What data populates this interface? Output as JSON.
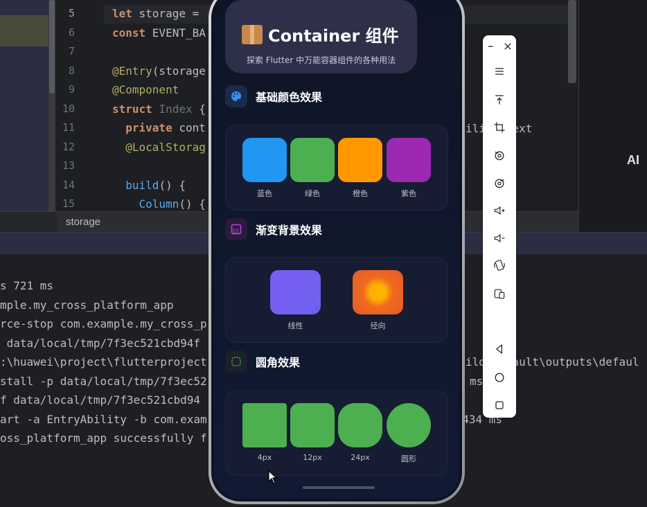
{
  "ide": {
    "line_numbers": [
      "5",
      "6",
      "7",
      "8",
      "9",
      "10",
      "11",
      "12",
      "13",
      "14",
      "15"
    ],
    "code_lines": [
      {
        "n": "5",
        "parts": [
          [
            "kw",
            "let "
          ],
          [
            "",
            "storage = "
          ]
        ]
      },
      {
        "n": "6",
        "parts": [
          [
            "kw",
            "const "
          ],
          [
            "",
            "EVENT_BA"
          ]
        ]
      },
      {
        "n": "7",
        "parts": []
      },
      {
        "n": "8",
        "parts": [
          [
            "ann",
            "@Entry"
          ],
          [
            "",
            "(storage"
          ]
        ]
      },
      {
        "n": "9",
        "parts": [
          [
            "ann",
            "@Component"
          ]
        ]
      },
      {
        "n": "10",
        "parts": [
          [
            "kw",
            "struct "
          ],
          [
            "typ",
            "Index "
          ],
          [
            "",
            "{"
          ]
        ]
      },
      {
        "n": "11",
        "parts": [
          [
            "",
            "  "
          ],
          [
            "kw",
            "private "
          ],
          [
            "",
            "cont"
          ]
        ]
      },
      {
        "n": "12",
        "parts": [
          [
            "",
            "  "
          ],
          [
            "ann",
            "@LocalStorag"
          ]
        ]
      },
      {
        "n": "13",
        "parts": []
      },
      {
        "n": "14",
        "parts": [
          [
            "",
            "  "
          ],
          [
            "fn",
            "build"
          ],
          [
            "",
            "() {"
          ]
        ]
      },
      {
        "n": "15",
        "parts": [
          [
            "",
            "    "
          ],
          [
            "fn",
            "Column"
          ],
          [
            "",
            "() {"
          ]
        ]
      }
    ],
    "right_code": "ili  ntext",
    "tab_label": "storage",
    "ai_label": "AI",
    "console_lines": [
      "s 721 ms",
      "mple.my_cross_platform_app",
      "rce-stop com.example.my_cross_p",
      " data/local/tmp/7f3ec521cbd94f",
      ":\\huawei\\project\\flutterproject",
      "stall -p data/local/tmp/7f3ec52",
      "f data/local/tmp/7f3ec521cbd94",
      "art -a EntryAbility -b com.exam",
      "oss_platform_app successfully f"
    ],
    "console_right": [
      {
        "text": "ild\\default\\outputs\\defaul",
        "line": 4
      },
      {
        "text": "ms",
        "line": 5
      },
      {
        "text": "n 434 ms",
        "line": 7
      }
    ]
  },
  "app": {
    "title": "Container 组件",
    "subtitle": "探索 Flutter 中万能容器组件的各种用法",
    "sections": [
      {
        "id": "colors",
        "title": "基础颜色效果",
        "icon": "palette-icon",
        "icon_bg": "#1a2a4a",
        "icon_color": "#3b8ff0",
        "items": [
          {
            "label": "蓝色",
            "color": "#2196f3"
          },
          {
            "label": "绿色",
            "color": "#4caf50"
          },
          {
            "label": "橙色",
            "color": "#ff9800"
          },
          {
            "label": "紫色",
            "color": "#9c27b0"
          }
        ]
      },
      {
        "id": "gradients",
        "title": "渐变背景效果",
        "icon": "gradient-icon",
        "icon_bg": "#2b1a3c",
        "icon_color": "#b04ad6",
        "items": [
          {
            "label": "线性",
            "type": "linear",
            "colors": [
              "#7b5cf5",
              "#6b63ec"
            ]
          },
          {
            "label": "径向",
            "type": "radial",
            "colors": [
              "#ffb300",
              "#f06a1e",
              "#e35a2b"
            ]
          }
        ]
      },
      {
        "id": "radius",
        "title": "圆角效果",
        "icon": "rounded-square-icon",
        "icon_bg": "#1c2028",
        "icon_color": "#4caf50",
        "items": [
          {
            "label": "4px",
            "radius": "4px"
          },
          {
            "label": "12px",
            "radius": "12px"
          },
          {
            "label": "24px",
            "radius": "24px"
          },
          {
            "label": "圆形",
            "radius": "circle"
          }
        ]
      }
    ]
  },
  "toolbar": {
    "buttons": [
      "minimize-icon",
      "close-icon",
      "menu-icon",
      "pin-top-icon",
      "crop-icon",
      "rotate-left-icon",
      "rotate-right-icon",
      "volume-up-icon",
      "volume-down-icon",
      "shake-icon",
      "multi-device-icon",
      "back-icon",
      "home-icon",
      "recents-icon"
    ]
  }
}
